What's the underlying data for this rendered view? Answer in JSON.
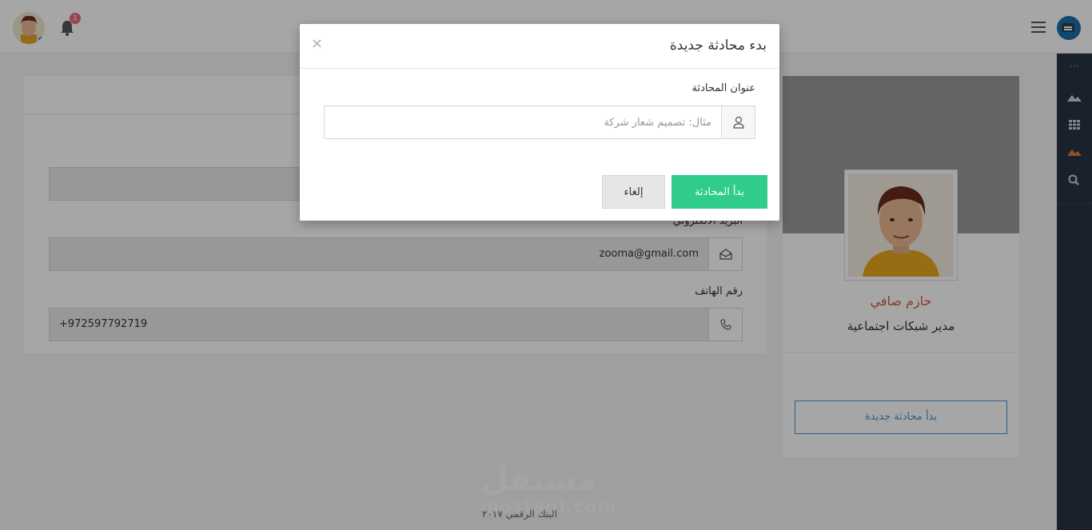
{
  "topbar": {
    "notification_count": "1"
  },
  "profile_form": {
    "email_label": "البريد الالكتروني",
    "email_value": "zooma@gmail.com",
    "phone_label": "رقم الهاتف",
    "phone_value": "+972597792719"
  },
  "profile_card": {
    "name": "حازم صافي",
    "role": "مدير شبكات اجتماعية",
    "start_chat_button": "بدأ محادثة جديدة"
  },
  "footer": {
    "text": "البنك الرقمي ٢٠١٧"
  },
  "watermark": {
    "text": "مستقل",
    "sub": "mostaql.com"
  },
  "modal": {
    "title": "بدء محادثة جديدة",
    "close_label": "×",
    "field_label": "عنوان المحادثة",
    "field_placeholder": "مثال: تصميم شعار شركة",
    "field_value": "",
    "start_button": "بدأ المحادثة",
    "cancel_button": "إلغاء"
  },
  "colors": {
    "primary_green": "#2fcc8b",
    "sidebar_dark": "#263444",
    "accent_blue": "#4a90c8",
    "name_orange": "#d35a3a",
    "badge_pink": "#e86a7e"
  },
  "icons": {
    "logo": "chat-bubble-icon",
    "menu": "hamburger-icon",
    "notifications": "bell-icon",
    "rail": [
      "more-dots-icon",
      "mountain-icon",
      "grid-icon",
      "mountain-active-icon",
      "search-icon"
    ],
    "email": "envelope-icon",
    "phone": "phone-icon",
    "modal_field": "user-icon"
  }
}
